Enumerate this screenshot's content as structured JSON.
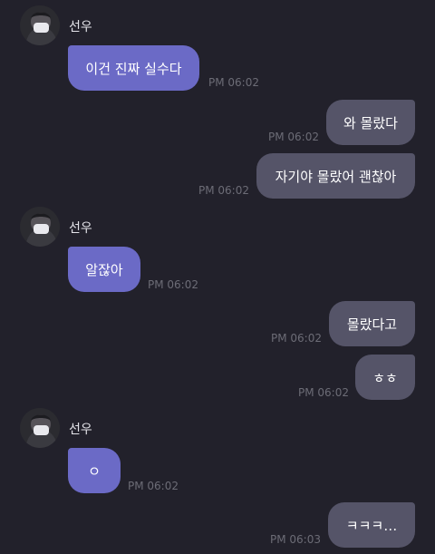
{
  "sender": {
    "name": "선우"
  },
  "messages": [
    {
      "dir": "in",
      "text": "이건 진짜 실수다",
      "time": "PM 06:02"
    },
    {
      "dir": "out",
      "text": "와 몰랐다",
      "time": "PM 06:02"
    },
    {
      "dir": "out",
      "text": "자기야 몰랐어 괜찮아",
      "time": "PM 06:02"
    },
    {
      "dir": "in",
      "text": "알잖아",
      "time": "PM 06:02"
    },
    {
      "dir": "out",
      "text": "몰랐다고",
      "time": "PM 06:02"
    },
    {
      "dir": "out",
      "text": "ㅎㅎ",
      "time": "PM 06:02"
    },
    {
      "dir": "in",
      "text": "ㅇ",
      "time": "PM 06:02"
    },
    {
      "dir": "out",
      "text": "ㅋㅋㅋ…",
      "time": "PM 06:03"
    }
  ],
  "colors": {
    "background": "#22212b",
    "incoming_bubble": "#6b6ac6",
    "outgoing_bubble": "#555468",
    "timestamp": "#6c6c76"
  }
}
